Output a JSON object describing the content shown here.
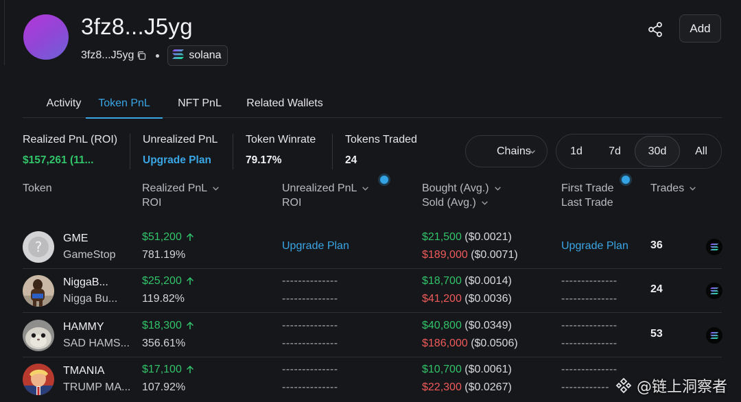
{
  "header": {
    "title": "3fz8...J5yg",
    "address_short": "3fz8...J5yg",
    "chain": "solana",
    "add_label": "Add"
  },
  "tabs": [
    {
      "label": "Activity"
    },
    {
      "label": "Token PnL"
    },
    {
      "label": "NFT PnL"
    },
    {
      "label": "Related Wallets"
    }
  ],
  "stats": {
    "realized_label": "Realized PnL (ROI)",
    "realized_value": "$157,261 (11...",
    "unrealized_label": "Unrealized PnL",
    "unrealized_value": "Upgrade Plan",
    "winrate_label": "Token Winrate",
    "winrate_value": "79.17%",
    "traded_label": "Tokens Traded",
    "traded_value": "24"
  },
  "filters": {
    "chains_label": "Chains",
    "ranges": [
      "1d",
      "7d",
      "30d",
      "All"
    ],
    "active_range": "30d"
  },
  "table": {
    "headers": {
      "token": "Token",
      "realized": "Realized PnL",
      "realized_sub": "ROI",
      "unrealized": "Unrealized PnL",
      "unrealized_sub": "ROI",
      "bought": "Bought (Avg.)",
      "sold": "Sold (Avg.)",
      "first_trade": "First Trade",
      "last_trade": "Last Trade",
      "trades": "Trades"
    },
    "rows": [
      {
        "symbol": "GME",
        "name": "GameStop",
        "pnl": "$51,200",
        "roi": "781.19%",
        "unrealized": "Upgrade Plan",
        "bought": "$21,500",
        "bought_avg": "($0.0021)",
        "sold": "$189,000",
        "sold_avg": "($0.0071)",
        "first_trade": "Upgrade Plan",
        "trades": "36"
      },
      {
        "symbol": "NiggaB...",
        "name": "Nigga Bu...",
        "pnl": "$25,200",
        "roi": "119.82%",
        "unrealized": "--------------",
        "unrealized_roi": "--------------",
        "bought": "$18,700",
        "bought_avg": "($0.0014)",
        "sold": "$41,200",
        "sold_avg": "($0.0036)",
        "first_trade": "--------------",
        "last_trade": "--------------",
        "trades": "24"
      },
      {
        "symbol": "HAMMY",
        "name": "SAD HAMS...",
        "pnl": "$18,300",
        "roi": "356.61%",
        "unrealized": "--------------",
        "unrealized_roi": "--------------",
        "bought": "$40,800",
        "bought_avg": "($0.0349)",
        "sold": "$186,000",
        "sold_avg": "($0.0506)",
        "first_trade": "--------------",
        "last_trade": "--------------",
        "trades": "53"
      },
      {
        "symbol": "TMANIA",
        "name": "TRUMP MA...",
        "pnl": "$17,100",
        "roi": "107.92%",
        "unrealized": "--------------",
        "unrealized_roi": "--------------",
        "bought": "$10,700",
        "bought_avg": "($0.0061)",
        "sold": "$22,300",
        "sold_avg": "($0.0267)",
        "first_trade": "--------------",
        "last_trade": "--------------"
      }
    ]
  },
  "watermark": "@链上洞察者",
  "colors": {
    "accent": "#3aa6e6",
    "positive": "#31c46a",
    "negative": "#f05a5a",
    "background": "#16171a"
  }
}
